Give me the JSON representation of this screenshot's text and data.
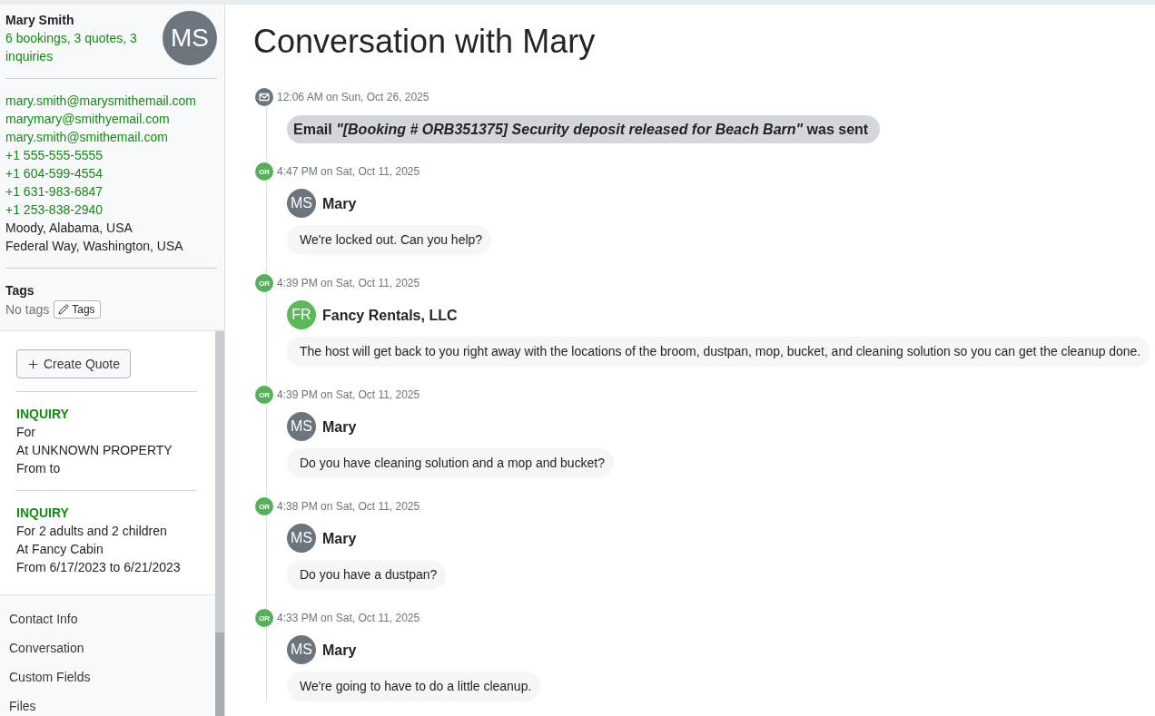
{
  "contact": {
    "name": "Mary Smith",
    "summary": "6 bookings, 3 quotes, 3 inquiries",
    "initials": "MS",
    "details": [
      {
        "kind": "email",
        "text": "mary.smith@marysmithemail.com"
      },
      {
        "kind": "email",
        "text": "marymary@smithyemail.com"
      },
      {
        "kind": "email",
        "text": "mary.smith@smithemail.com"
      },
      {
        "kind": "phone",
        "text": "+1 555-555-5555"
      },
      {
        "kind": "phone",
        "text": "+1 604-599-4554"
      },
      {
        "kind": "phone",
        "text": "+1 631-983-6847"
      },
      {
        "kind": "phone",
        "text": "+1 253-838-2940"
      },
      {
        "kind": "address",
        "text": "Moody, Alabama, USA"
      },
      {
        "kind": "address",
        "text": "Federal Way, Washington, USA"
      }
    ]
  },
  "tags": {
    "title": "Tags",
    "empty_text": "No tags",
    "button": "Tags"
  },
  "create_quote_button": "Create Quote",
  "inquiries": [
    {
      "status": "INQUIRY",
      "lines": [
        "For",
        "At UNKNOWN PROPERTY",
        "From to"
      ]
    },
    {
      "status": "INQUIRY",
      "lines": [
        "For 2 adults and 2 children",
        "At Fancy Cabin",
        "From 6/17/2023 to 6/21/2023"
      ]
    }
  ],
  "nav": [
    {
      "label": "Contact Info"
    },
    {
      "label": "Conversation"
    },
    {
      "label": "Custom Fields"
    },
    {
      "label": "Files"
    }
  ],
  "conversation": {
    "title": "Conversation with Mary",
    "events": [
      {
        "kind": "email",
        "time": "12:06 AM on Sun, Oct 26, 2025",
        "text": "Email *\"[Booking # ORB351375] Security deposit released for Beach Barn\"* was sent"
      },
      {
        "kind": "message",
        "badge": "OR",
        "time": "4:47 PM on Sat, Oct 11, 2025",
        "sender": {
          "name": "Mary",
          "initials": "MS",
          "color": "#6c757d"
        },
        "text": "We're locked out. Can you help?"
      },
      {
        "kind": "message",
        "badge": "OR",
        "time": "4:39 PM on Sat, Oct 11, 2025",
        "sender": {
          "name": "Fancy Rentals, LLC",
          "initials": "FR",
          "color": "#5cb85c"
        },
        "text": "The host will get back to you right away with the locations of the broom, dustpan, mop, bucket, and cleaning solution so you can get the cleanup done."
      },
      {
        "kind": "message",
        "badge": "OR",
        "time": "4:39 PM on Sat, Oct 11, 2025",
        "sender": {
          "name": "Mary",
          "initials": "MS",
          "color": "#6c757d"
        },
        "text": "Do you have cleaning solution and a mop and bucket?"
      },
      {
        "kind": "message",
        "badge": "OR",
        "time": "4:38 PM on Sat, Oct 11, 2025",
        "sender": {
          "name": "Mary",
          "initials": "MS",
          "color": "#6c757d"
        },
        "text": "Do you have a dustpan?"
      },
      {
        "kind": "message",
        "badge": "OR",
        "time": "4:33 PM on Sat, Oct 11, 2025",
        "sender": {
          "name": "Mary",
          "initials": "MS",
          "color": "#6c757d"
        },
        "text": "We're going to have to do a little cleanup."
      }
    ]
  }
}
